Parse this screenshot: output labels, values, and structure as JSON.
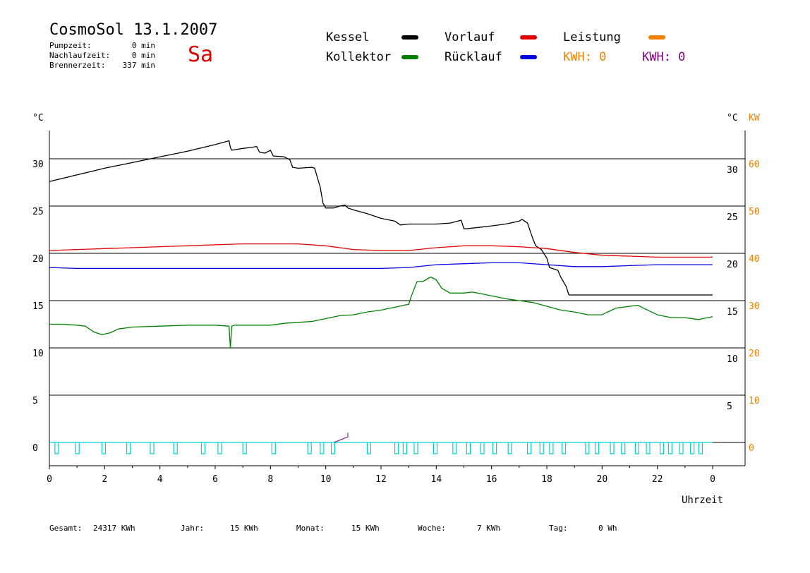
{
  "header": {
    "title": "CosmoSol 13.1.2007",
    "stats": [
      {
        "label": "Pumpzeit:",
        "value": "0 min"
      },
      {
        "label": "Nachlaufzeit:",
        "value": "0 min"
      },
      {
        "label": "Brennerzeit:",
        "value": "337 min"
      }
    ],
    "day": "Sa",
    "day_color": "#e00000"
  },
  "legend": {
    "kessel": "Kessel",
    "kollektor": "Kollektor",
    "vorlauf": "Vorlauf",
    "ruecklauf": "Rücklauf",
    "leistung": "Leistung",
    "kwh_orange": "KWH: 0",
    "kwh_purple": "KWH: 0"
  },
  "colors": {
    "kessel": "#000000",
    "kollektor": "#008000",
    "vorlauf": "#e00000",
    "ruecklauf": "#0000e0",
    "leistung": "#f08000",
    "kwh_purple": "#800080",
    "pump": "#00d0d0"
  },
  "footer": {
    "gesamt_label": "Gesamt:",
    "gesamt_value": "24317 KWh",
    "jahr_label": "Jahr:",
    "jahr_value": "15 KWh",
    "monat_label": "Monat:",
    "monat_value": "15 KWh",
    "woche_label": "Woche:",
    "woche_value": "7 KWh",
    "tag_label": "Tag:",
    "tag_value": "0 Wh"
  },
  "chart_data": {
    "type": "line",
    "xlabel": "Uhrzeit",
    "ylabel_left": "°C",
    "ylabel_right": "°C",
    "ylabel_right2": "KW",
    "xlim": [
      0,
      24
    ],
    "ylim": [
      -2.5,
      35
    ],
    "x_ticks": [
      "0",
      "2",
      "4",
      "6",
      "8",
      "10",
      "12",
      "14",
      "16",
      "18",
      "20",
      "22",
      "0"
    ],
    "y_ticks_left": [
      "0",
      "5",
      "10",
      "15",
      "20",
      "25",
      "30"
    ],
    "y_ticks_right": [
      "5",
      "10",
      "15",
      "20",
      "25",
      "30"
    ],
    "y_ticks_kw": [
      "0",
      "10",
      "20",
      "30",
      "40",
      "50",
      "60"
    ],
    "grid": "horizontal",
    "series": [
      {
        "name": "Kessel",
        "key": "kessel",
        "x": [
          0,
          1,
          2,
          3,
          4,
          5,
          6,
          6.5,
          6.55,
          6.6,
          7,
          7.3,
          7.5,
          7.6,
          7.8,
          8,
          8.1,
          8.5,
          8.7,
          8.8,
          9,
          9.5,
          9.6,
          9.8,
          9.9,
          10,
          10.3,
          10.5,
          10.7,
          10.8,
          11,
          11.5,
          12,
          12.5,
          12.7,
          13,
          13.5,
          14,
          14.5,
          14.9,
          15,
          15.1,
          16,
          16.5,
          17,
          17.1,
          17.3,
          17.5,
          17.6,
          17.8,
          18,
          18.1,
          18.4,
          18.5,
          18.7,
          18.8,
          19,
          20,
          21,
          22,
          23,
          24
        ],
        "y": [
          27.6,
          28.3,
          29,
          29.6,
          30.2,
          30.8,
          31.5,
          31.9,
          31.2,
          30.9,
          31.1,
          31.2,
          31.3,
          30.7,
          30.6,
          30.9,
          30.3,
          30.2,
          29.9,
          29.1,
          29,
          29.1,
          29,
          27,
          25.3,
          24.8,
          24.8,
          25,
          25.1,
          24.8,
          24.6,
          24.2,
          23.7,
          23.4,
          23,
          23.1,
          23.1,
          23.1,
          23.2,
          23.5,
          22.6,
          22.6,
          22.9,
          23.1,
          23.4,
          23.6,
          23.2,
          21.5,
          20.8,
          20.4,
          19.5,
          18.5,
          18.2,
          17.5,
          16.5,
          15.6,
          15.6,
          15.6,
          15.6,
          15.6,
          15.6,
          15.6
        ]
      },
      {
        "name": "Vorlauf",
        "key": "vorlauf",
        "x": [
          0,
          1,
          2,
          3,
          4,
          5,
          6,
          7,
          8,
          9,
          10,
          10.5,
          11,
          12,
          13,
          14,
          15,
          16,
          17,
          18,
          19,
          20,
          21,
          22,
          23,
          24
        ],
        "y": [
          20.3,
          20.4,
          20.5,
          20.6,
          20.7,
          20.8,
          20.9,
          21,
          21,
          21,
          20.8,
          20.6,
          20.4,
          20.3,
          20.3,
          20.6,
          20.8,
          20.8,
          20.7,
          20.5,
          20.1,
          19.8,
          19.7,
          19.6,
          19.6,
          19.6
        ]
      },
      {
        "name": "Rücklauf",
        "key": "ruecklauf",
        "x": [
          0,
          1,
          2,
          4,
          6,
          8,
          10,
          11,
          12,
          13,
          14,
          15,
          16,
          17,
          18,
          19,
          20,
          21,
          22,
          23,
          24
        ],
        "y": [
          18.5,
          18.4,
          18.4,
          18.4,
          18.4,
          18.4,
          18.4,
          18.4,
          18.4,
          18.5,
          18.8,
          18.9,
          19,
          19,
          18.8,
          18.6,
          18.6,
          18.7,
          18.8,
          18.8,
          18.8
        ]
      },
      {
        "name": "Kollektor",
        "key": "kollektor",
        "x": [
          0,
          0.5,
          1,
          1.3,
          1.6,
          1.9,
          2.2,
          2.5,
          3,
          4,
          5,
          6,
          6.5,
          6.55,
          6.6,
          6.7,
          7,
          8,
          8.5,
          9,
          9.5,
          10,
          10.5,
          11,
          11.5,
          12,
          12.5,
          12.8,
          13,
          13.1,
          13.3,
          13.5,
          13.8,
          14,
          14.2,
          14.5,
          15,
          15.3,
          15.5,
          16,
          16.5,
          17,
          17.5,
          18,
          18.5,
          19,
          19.5,
          20,
          20.2,
          20.5,
          21,
          21.3,
          21.5,
          22,
          22.5,
          23,
          23.5,
          24
        ],
        "y": [
          12.5,
          12.5,
          12.4,
          12.3,
          11.7,
          11.4,
          11.6,
          12,
          12.2,
          12.3,
          12.4,
          12.4,
          12.3,
          10,
          12.3,
          12.4,
          12.4,
          12.4,
          12.6,
          12.7,
          12.8,
          13.1,
          13.4,
          13.5,
          13.8,
          14,
          14.3,
          14.5,
          14.6,
          15.5,
          17,
          17,
          17.5,
          17.2,
          16.3,
          15.8,
          15.8,
          15.9,
          15.8,
          15.5,
          15.2,
          15,
          14.8,
          14.4,
          14,
          13.8,
          13.5,
          13.5,
          13.8,
          14.2,
          14.4,
          14.5,
          14.2,
          13.5,
          13.2,
          13.2,
          13,
          13.3
        ]
      }
    ],
    "pump_pulses_h": [
      0.2,
      0.95,
      1.9,
      2.8,
      3.65,
      4.5,
      5.5,
      6.1,
      7,
      8.05,
      9.35,
      9.8,
      10.2,
      11.5,
      12.5,
      12.8,
      13.2,
      13.9,
      14.6,
      15.1,
      15.6,
      16.05,
      16.6,
      17.3,
      17.75,
      18.1,
      18.55,
      19.4,
      19.75,
      20.3,
      20.7,
      21.2,
      21.6,
      22.1,
      22.4,
      22.8,
      23.2,
      23.5
    ],
    "pump_spike_h": [
      10.3,
      10.8
    ]
  }
}
